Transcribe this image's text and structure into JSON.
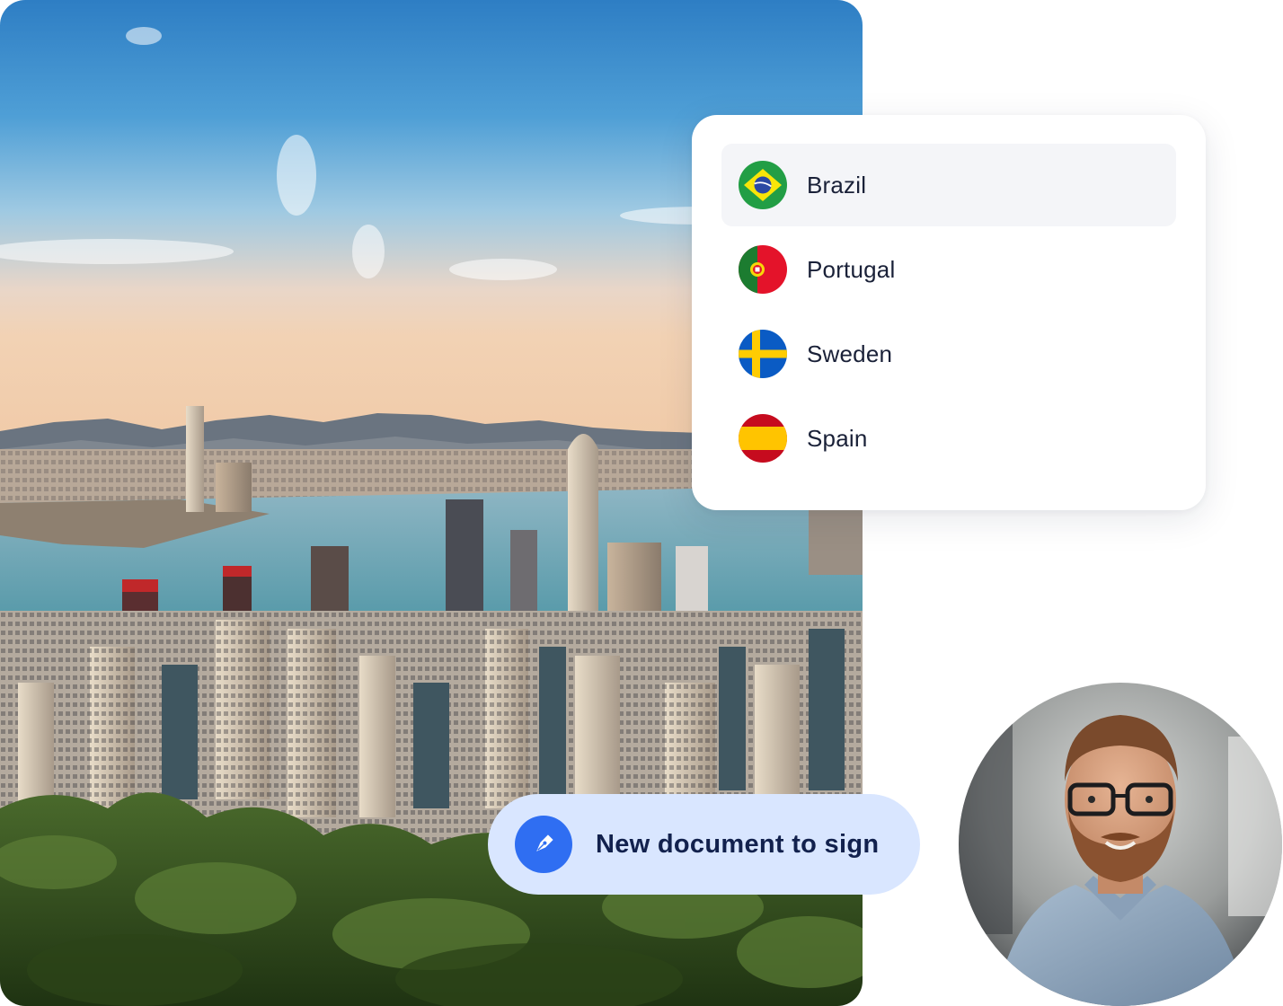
{
  "countries": {
    "items": [
      {
        "label": "Brazil",
        "icon": "brazil-flag-icon",
        "selected": true
      },
      {
        "label": "Portugal",
        "icon": "portugal-flag-icon",
        "selected": false
      },
      {
        "label": "Sweden",
        "icon": "sweden-flag-icon",
        "selected": false
      },
      {
        "label": "Spain",
        "icon": "spain-flag-icon",
        "selected": false
      }
    ]
  },
  "notification": {
    "label": "New document to sign",
    "icon": "pen-icon",
    "accent": "#2f6ef2",
    "background": "#d9e6ff"
  },
  "colors": {
    "text": "#1a2138",
    "selected_row": "#f4f5f8"
  }
}
